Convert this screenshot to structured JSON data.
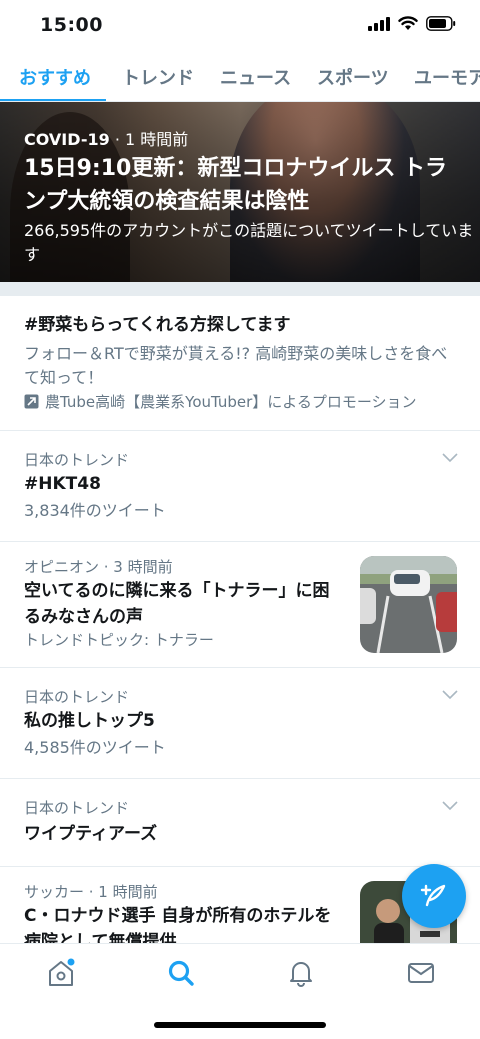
{
  "status_bar": {
    "time": "15:00"
  },
  "tabs": [
    {
      "label": "おすすめ",
      "active": true
    },
    {
      "label": "トレンド",
      "active": false
    },
    {
      "label": "ニュース",
      "active": false
    },
    {
      "label": "スポーツ",
      "active": false
    },
    {
      "label": "ユーモア",
      "active": false
    }
  ],
  "hero": {
    "source": "COVID-19",
    "time": "1 時間前",
    "title": "15日9:10更新：新型コロナウイルス トランプ大統領の検査結果は陰性",
    "subtitle": "266,595件のアカウントがこの話題についてツイートしています"
  },
  "promoted": {
    "title": "#野菜もらってくれる方探してます",
    "description": "フォロー＆RTで野菜が貰える!? 高崎野菜の美味しさを食べて知って！",
    "promoted_by": "農Tube高崎【農業系YouTuber】によるプロモーション"
  },
  "trends": [
    {
      "meta": "日本のトレンド",
      "title": "#HKT48",
      "count": "3,834件のツイート"
    },
    {
      "meta": "オピニオン · 3 時間前",
      "title": "空いてるのに隣に来る「トナラー」に困るみなさんの声",
      "topic": "トレンドトピック: トナラー"
    },
    {
      "meta": "日本のトレンド",
      "title": "私の推しトップ5",
      "count": "4,585件のツイート"
    },
    {
      "meta": "日本のトレンド",
      "title": "ワイプティアーズ"
    },
    {
      "meta": "サッカー · 1 時間前",
      "title": "C・ロナウド選手 自身が所有のホテルを病院として無償提供"
    }
  ],
  "icons": {
    "home": "home-icon",
    "search": "search-icon",
    "notifications": "bell-icon",
    "messages": "mail-icon",
    "compose": "compose-tweet-icon",
    "more": "chevron-down-icon"
  },
  "colors": {
    "accent": "#1da1f2",
    "secondary_text": "#657786",
    "divider": "#e6ecf0"
  }
}
